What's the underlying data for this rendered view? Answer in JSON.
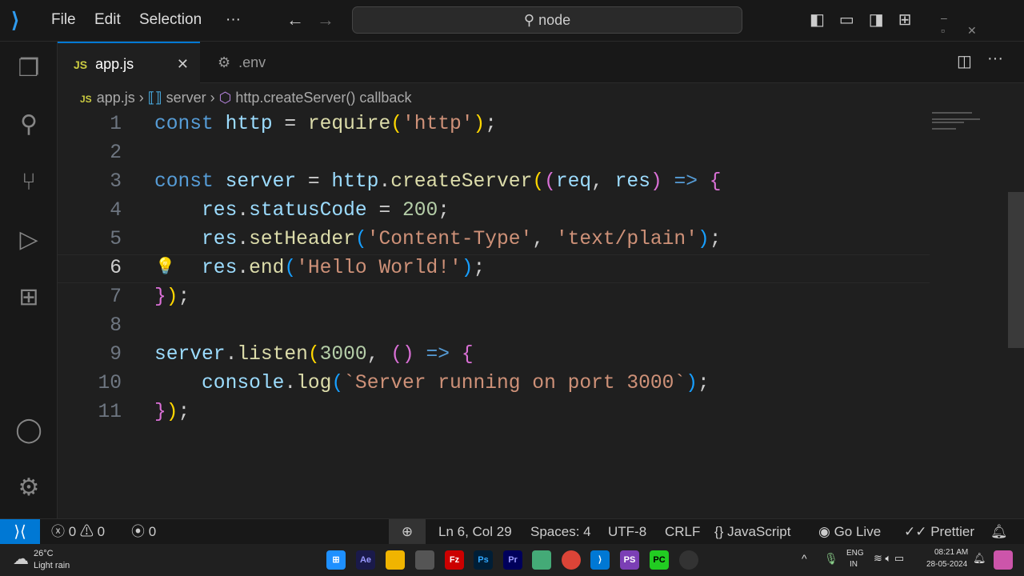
{
  "titlebar": {
    "menu": [
      "File",
      "Edit",
      "Selection",
      "···"
    ],
    "search": "node"
  },
  "tabs": [
    {
      "label": "app.js",
      "icon": "JS",
      "close": "✕"
    },
    {
      "label": ".env",
      "icon": "⚙"
    }
  ],
  "breadcrumb": [
    "app.js",
    "server",
    "http.createServer() callback"
  ],
  "editor": {
    "current_line": 6,
    "lines": [
      [
        [
          "const",
          "kw"
        ],
        [
          " ",
          "p"
        ],
        [
          "http",
          "var"
        ],
        [
          " = ",
          "p"
        ],
        [
          "require",
          "fn"
        ],
        [
          "(",
          "b1"
        ],
        [
          "'http'",
          "str"
        ],
        [
          ")",
          "b1"
        ],
        [
          ";",
          "p"
        ]
      ],
      [],
      [
        [
          "const",
          "kw"
        ],
        [
          " ",
          "p"
        ],
        [
          "server",
          "var"
        ],
        [
          " = ",
          "p"
        ],
        [
          "http",
          "var"
        ],
        [
          ".",
          "p"
        ],
        [
          "createServer",
          "fn"
        ],
        [
          "(",
          "b1"
        ],
        [
          "(",
          "b2"
        ],
        [
          "req",
          "var"
        ],
        [
          ", ",
          "p"
        ],
        [
          "res",
          "var"
        ],
        [
          ")",
          "b2"
        ],
        [
          " ",
          "p"
        ],
        [
          "=>",
          "kw"
        ],
        [
          " ",
          "p"
        ],
        [
          "{",
          "b2"
        ]
      ],
      [
        [
          "    ",
          "p"
        ],
        [
          "res",
          "var"
        ],
        [
          ".",
          "p"
        ],
        [
          "statusCode",
          "var"
        ],
        [
          " = ",
          "p"
        ],
        [
          "200",
          "num"
        ],
        [
          ";",
          "p"
        ]
      ],
      [
        [
          "    ",
          "p"
        ],
        [
          "res",
          "var"
        ],
        [
          ".",
          "p"
        ],
        [
          "setHeader",
          "fn"
        ],
        [
          "(",
          "b3"
        ],
        [
          "'Content-Type'",
          "str"
        ],
        [
          ", ",
          "p"
        ],
        [
          "'text/plain'",
          "str"
        ],
        [
          ")",
          "b3"
        ],
        [
          ";",
          "p"
        ]
      ],
      [
        [
          "    ",
          "p"
        ],
        [
          "res",
          "var"
        ],
        [
          ".",
          "p"
        ],
        [
          "end",
          "fn"
        ],
        [
          "(",
          "b3"
        ],
        [
          "'Hello World!'",
          "str"
        ],
        [
          ")",
          "b3"
        ],
        [
          ";",
          "p"
        ]
      ],
      [
        [
          "}",
          "b2"
        ],
        [
          ")",
          "b1"
        ],
        [
          ";",
          "p"
        ]
      ],
      [],
      [
        [
          "server",
          "var"
        ],
        [
          ".",
          "p"
        ],
        [
          "listen",
          "fn"
        ],
        [
          "(",
          "b1"
        ],
        [
          "3000",
          "num"
        ],
        [
          ", ",
          "p"
        ],
        [
          "()",
          "b2"
        ],
        [
          " ",
          "p"
        ],
        [
          "=>",
          "kw"
        ],
        [
          " ",
          "p"
        ],
        [
          "{",
          "b2"
        ]
      ],
      [
        [
          "    ",
          "p"
        ],
        [
          "console",
          "var"
        ],
        [
          ".",
          "p"
        ],
        [
          "log",
          "fn"
        ],
        [
          "(",
          "b3"
        ],
        [
          "`Server running on port 3000`",
          "str"
        ],
        [
          ")",
          "b3"
        ],
        [
          ";",
          "p"
        ]
      ],
      [
        [
          "}",
          "b2"
        ],
        [
          ")",
          "b1"
        ],
        [
          ";",
          "p"
        ]
      ]
    ]
  },
  "status": {
    "errors": "0",
    "warnings": "0",
    "ports": "0",
    "position": "Ln 6, Col 29",
    "spaces": "Spaces: 4",
    "encoding": "UTF-8",
    "eol": "CRLF",
    "language": "JavaScript",
    "golive": "Go Live",
    "prettier": "Prettier"
  },
  "taskbar": {
    "temp": "26°C",
    "weather": "Light rain",
    "lang1": "ENG",
    "lang2": "IN",
    "time": "08:21 AM",
    "date": "28-05-2024"
  }
}
